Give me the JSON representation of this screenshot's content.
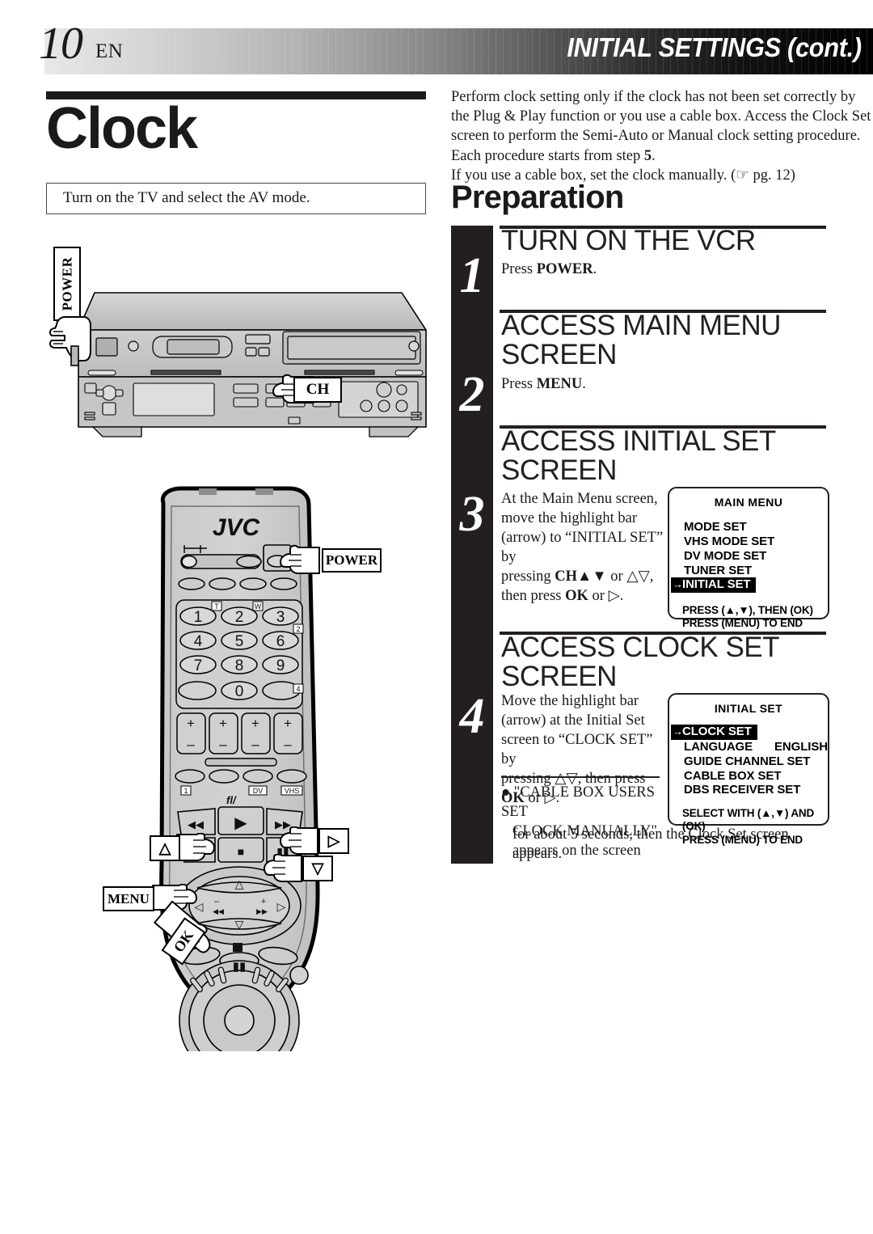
{
  "header": {
    "page_number": "10",
    "language_code": "EN",
    "title": "INITIAL SETTINGS (cont.)"
  },
  "left": {
    "section_title": "Clock",
    "preparation_note": "Turn on the TV and select the AV mode.",
    "vcr_callouts": {
      "power": "POWER",
      "channel": "CH"
    },
    "remote": {
      "brand": "JVC",
      "callout_power": "POWER",
      "callout_menu": "MENU",
      "callout_ok": "OK",
      "callout_up": "△",
      "callout_down": "▽",
      "callout_right": "▷",
      "keypad": [
        "1",
        "2",
        "3",
        "4",
        "5",
        "6",
        "7",
        "8",
        "9",
        "0"
      ],
      "key_hints": [
        "T",
        "W",
        "2",
        "4"
      ],
      "deck_labels": [
        "1",
        "DV",
        "VHS"
      ],
      "plusminus": [
        "+",
        "−"
      ]
    }
  },
  "right": {
    "intro": "Perform clock setting only if the clock has not been set correctly by the Plug & Play function or you use a cable box. Access the Clock Set screen to perform the Semi-Auto or Manual clock setting procedure. Each procedure starts from step ",
    "intro_step_bold": "5",
    "intro_tail": ".",
    "intro_line2": "If you use a cable box, set the clock manually. (☞ pg. 12)",
    "preparation_heading": "Preparation",
    "steps": [
      {
        "number": "1",
        "heading": "TURN ON THE VCR",
        "body_pre": "Press ",
        "body_bold": "POWER",
        "body_post": "."
      },
      {
        "number": "2",
        "heading": "ACCESS MAIN MENU SCREEN",
        "body_pre": "Press ",
        "body_bold": "MENU",
        "body_post": "."
      },
      {
        "number": "3",
        "heading": "ACCESS INITIAL SET SCREEN",
        "body_l1": "At the Main Menu screen,",
        "body_l2": "move the highlight bar",
        "body_l3": "(arrow) to “INITIAL SET” by",
        "body_l4_pre": "pressing ",
        "body_l4_bold": "CH▲▼",
        "body_l4_mid": " or △▽,",
        "body_l5_pre": "then press ",
        "body_l5_bold": "OK",
        "body_l5_post": " or ▷."
      },
      {
        "number": "4",
        "heading": "ACCESS CLOCK SET SCREEN",
        "body_l1": "Move the highlight bar",
        "body_l2": "(arrow) at the Initial Set",
        "body_l3": "screen to “CLOCK SET” by",
        "body_l4": "pressing △▽, then press",
        "body_l5_bold": "OK",
        "body_l5_post": " or ▷.",
        "bullet_l1": "● \"CABLE BOX USERS SET",
        "bullet_l2": "CLOCK MANUALLY\"",
        "bullet_l3": "appears on the screen",
        "bullet_l4": "for about 5 seconds, then the Clock Set screen",
        "bullet_l5": "appears."
      }
    ],
    "osd_main_menu": {
      "title": "MAIN MENU",
      "items": [
        "MODE SET",
        "VHS MODE SET",
        "DV MODE SET",
        "TUNER SET"
      ],
      "highlighted": "INITIAL SET",
      "highlight_arrow": "→",
      "footer_l1": "PRESS (▲,▼), THEN (OK)",
      "footer_l2": "PRESS (MENU) TO END"
    },
    "osd_initial_set": {
      "title": "INITIAL SET",
      "highlighted": "CLOCK SET",
      "highlight_arrow": "→",
      "items": [
        "LANGUAGE",
        "GUIDE CHANNEL SET",
        "CABLE BOX SET",
        "DBS RECEIVER SET"
      ],
      "language_value": "ENGLISH",
      "footer_l1": "SELECT WITH (▲,▼) AND (OK)",
      "footer_l2": "PRESS (MENU) TO END"
    }
  }
}
